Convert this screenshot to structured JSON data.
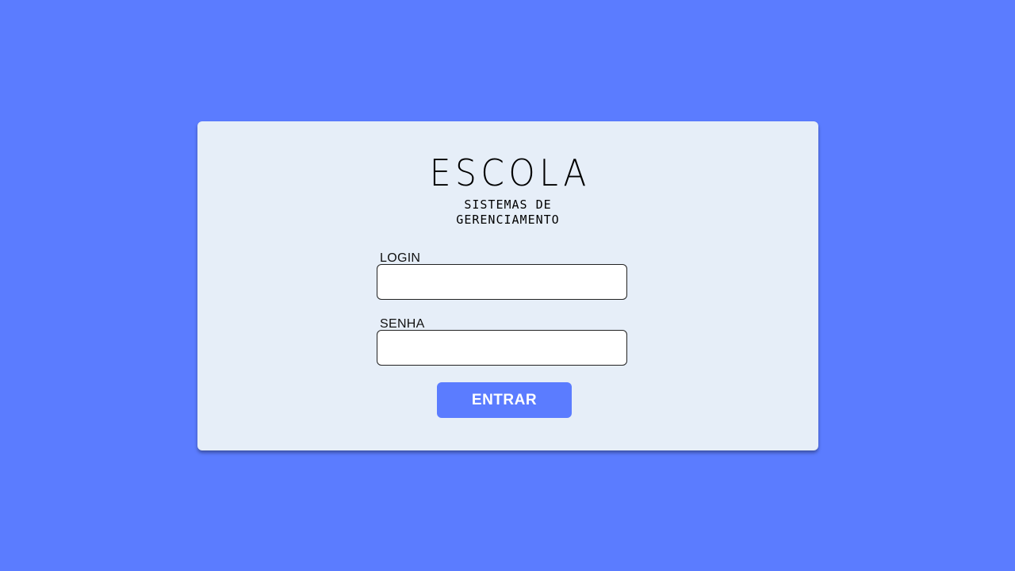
{
  "logo": {
    "title": "ESCOLA",
    "subtitle_line1": "SISTEMAS DE",
    "subtitle_line2": "GERENCIAMENTO"
  },
  "form": {
    "login_label": "LOGIN",
    "login_value": "",
    "senha_label": "SENHA",
    "senha_value": "",
    "submit_label": "ENTRAR"
  },
  "colors": {
    "background": "#5b7cff",
    "card": "#e6eef8",
    "button": "#5b7cff",
    "button_text": "#ffffff"
  }
}
